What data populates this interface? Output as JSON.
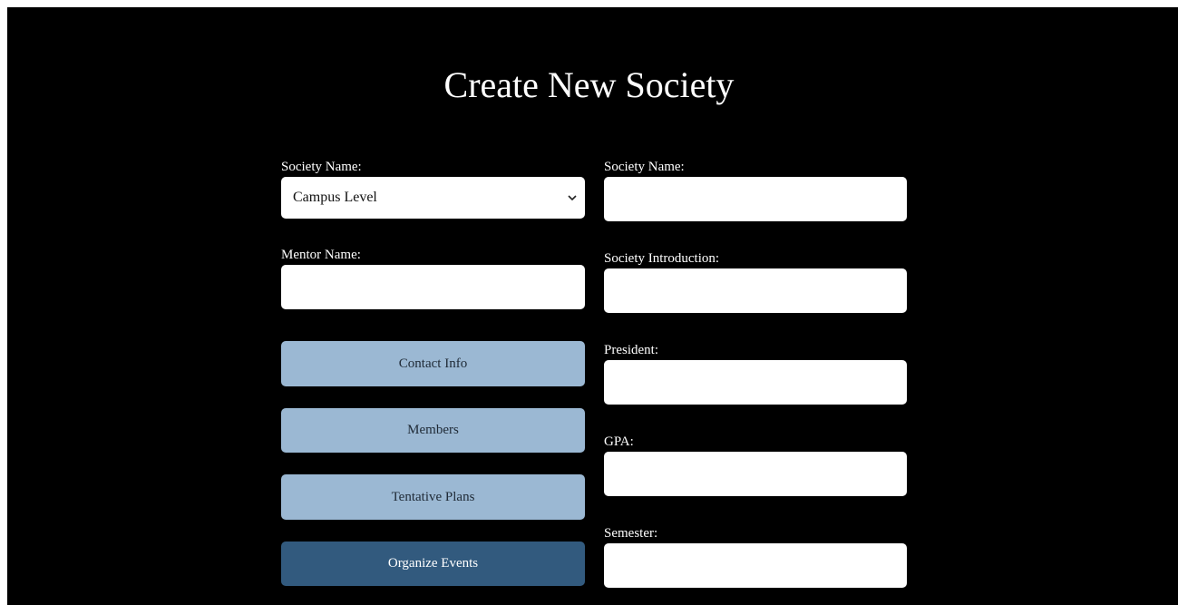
{
  "page": {
    "title": "Create New Society"
  },
  "left_form": {
    "society_level_label": "Society Name:",
    "society_level_value": "Campus Level",
    "mentor_name_label": "Mentor Name:",
    "mentor_name_value": ""
  },
  "right_form": {
    "society_name_label": "Society Name:",
    "society_name_value": "",
    "society_intro_label": "Society Introduction:",
    "society_intro_value": "",
    "president_label": "President:",
    "president_value": "",
    "gpa_label": "GPA:",
    "gpa_value": "",
    "semester_label": "Semester:",
    "semester_value": ""
  },
  "buttons": {
    "contact_info": "Contact Info",
    "members": "Members",
    "tentative_plans": "Tentative Plans",
    "organize_events": "Organize Events"
  },
  "colors": {
    "background": "#000000",
    "button_light": "#9bb8d3",
    "button_active": "#325a7e",
    "input_background": "#ffffff"
  },
  "icons": {
    "select_arrow": "chevron-down-icon"
  }
}
